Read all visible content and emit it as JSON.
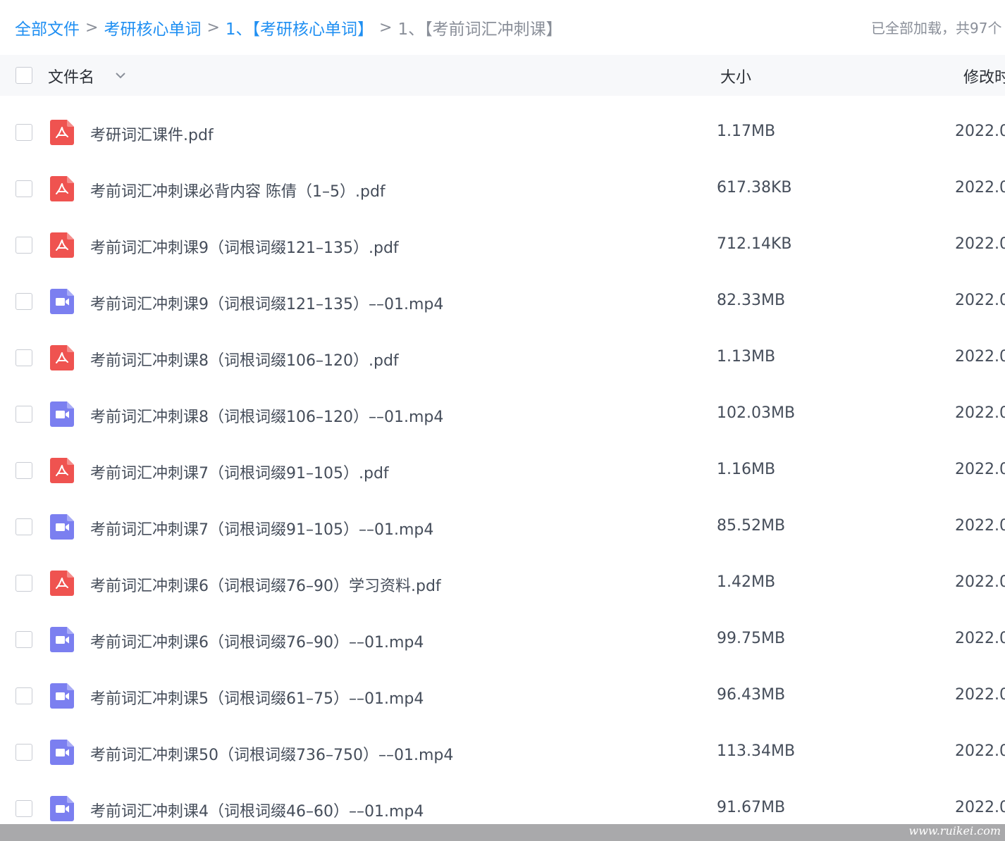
{
  "breadcrumb": [
    {
      "label": "全部文件",
      "active": true
    },
    {
      "label": "考研核心单词",
      "active": true
    },
    {
      "label": "1、【考研核心单词】",
      "active": true
    },
    {
      "label": "1、【考前词汇冲刺课】",
      "active": false
    }
  ],
  "breadcrumb_separator": ">",
  "load_status": "已全部加载，共97个",
  "header": {
    "name_label": "文件名",
    "size_label": "大小",
    "time_label": "修改时间"
  },
  "files": [
    {
      "name": "考研词汇课件.pdf",
      "size": "1.17MB",
      "time": "2022.0",
      "type": "pdf-icon"
    },
    {
      "name": "考前词汇冲刺课必背内容 陈倩（1–5）.pdf",
      "size": "617.38KB",
      "time": "2022.0",
      "type": "pdf-icon"
    },
    {
      "name": "考前词汇冲刺课9（词根词缀121–135）.pdf",
      "size": "712.14KB",
      "time": "2022.0",
      "type": "pdf-icon"
    },
    {
      "name": "考前词汇冲刺课9（词根词缀121–135）––01.mp4",
      "size": "82.33MB",
      "time": "2022.0",
      "type": "video-icon"
    },
    {
      "name": "考前词汇冲刺课8（词根词缀106–120）.pdf",
      "size": "1.13MB",
      "time": "2022.0",
      "type": "pdf-icon"
    },
    {
      "name": "考前词汇冲刺课8（词根词缀106–120）––01.mp4",
      "size": "102.03MB",
      "time": "2022.0",
      "type": "video-icon"
    },
    {
      "name": "考前词汇冲刺课7（词根词缀91–105）.pdf",
      "size": "1.16MB",
      "time": "2022.0",
      "type": "pdf-icon"
    },
    {
      "name": "考前词汇冲刺课7（词根词缀91–105）––01.mp4",
      "size": "85.52MB",
      "time": "2022.0",
      "type": "video-icon"
    },
    {
      "name": "考前词汇冲刺课6（词根词缀76–90）学习资料.pdf",
      "size": "1.42MB",
      "time": "2022.0",
      "type": "pdf-icon"
    },
    {
      "name": "考前词汇冲刺课6（词根词缀76–90）––01.mp4",
      "size": "99.75MB",
      "time": "2022.0",
      "type": "video-icon"
    },
    {
      "name": "考前词汇冲刺课5（词根词缀61–75）––01.mp4",
      "size": "96.43MB",
      "time": "2022.0",
      "type": "video-icon"
    },
    {
      "name": "考前词汇冲刺课50（词根词缀736–750）––01.mp4",
      "size": "113.34MB",
      "time": "2022.0",
      "type": "video-icon"
    },
    {
      "name": "考前词汇冲刺课4（词根词缀46–60）––01.mp4",
      "size": "91.67MB",
      "time": "2022.0",
      "type": "video-icon"
    }
  ],
  "watermark": "www.ruikei.com",
  "colors": {
    "link": "#1f8ff2",
    "pdf": "#ef5350",
    "video": "#7b7ff0",
    "muted": "#8a8f99"
  }
}
